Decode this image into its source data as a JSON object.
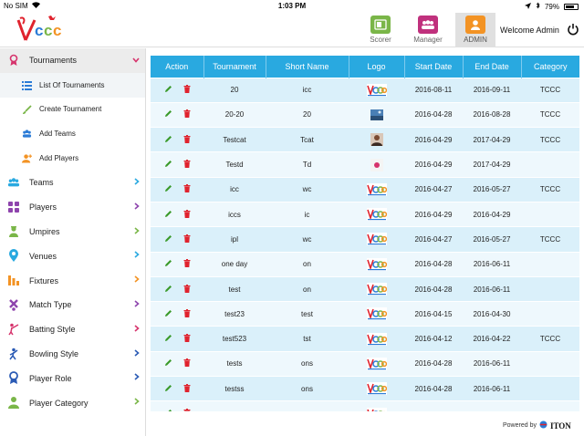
{
  "status": {
    "carrier": "No SIM",
    "time": "1:03 PM",
    "battery": "79%",
    "battery_level": 0.79
  },
  "header": {
    "tabs": [
      {
        "label": "Scorer",
        "color": "#7ab648",
        "active": false
      },
      {
        "label": "Manager",
        "color": "#c0317d",
        "active": false
      },
      {
        "label": "ADMIN",
        "color": "#f39324",
        "active": true
      }
    ],
    "welcome": "Welcome Admin"
  },
  "sidebar": {
    "items": [
      {
        "label": "Tournaments",
        "icon": "award-icon",
        "color": "#d6336c",
        "open": true
      },
      {
        "label": "List Of Tournaments",
        "icon": "list-icon",
        "color": "#2b7bd6",
        "sub": true,
        "selected": true
      },
      {
        "label": "Create Tournament",
        "icon": "brush-icon",
        "color": "#7ab648",
        "sub": true
      },
      {
        "label": "Add Teams",
        "icon": "group-icon",
        "color": "#2b7bd6",
        "sub": true
      },
      {
        "label": "Add Players",
        "icon": "add-player-icon",
        "color": "#f39324",
        "sub": true
      },
      {
        "label": "Teams",
        "icon": "teams-icon",
        "color": "#29a9e0",
        "chev_color": "#29a9e0"
      },
      {
        "label": "Players",
        "icon": "players-icon",
        "color": "#8e44ad",
        "chev_color": "#8e44ad"
      },
      {
        "label": "Umpires",
        "icon": "umpire-icon",
        "color": "#7ab648",
        "chev_color": "#7ab648"
      },
      {
        "label": "Venues",
        "icon": "location-icon",
        "color": "#29a9e0",
        "chev_color": "#29a9e0"
      },
      {
        "label": "Fixtures",
        "icon": "fixtures-icon",
        "color": "#f39324",
        "chev_color": "#f39324"
      },
      {
        "label": "Match Type",
        "icon": "match-type-icon",
        "color": "#8e44ad",
        "chev_color": "#8e44ad"
      },
      {
        "label": "Batting Style",
        "icon": "batting-icon",
        "color": "#d6336c",
        "chev_color": "#d6336c"
      },
      {
        "label": "Bowling Style",
        "icon": "bowling-icon",
        "color": "#2b5bb5",
        "chev_color": "#2b5bb5"
      },
      {
        "label": "Player Role",
        "icon": "role-icon",
        "color": "#2b5bb5",
        "chev_color": "#2b5bb5"
      },
      {
        "label": "Player Category",
        "icon": "category-icon",
        "color": "#7ab648",
        "chev_color": "#7ab648"
      }
    ]
  },
  "table": {
    "headers": [
      "Action",
      "Tournament",
      "Short Name",
      "Logo",
      "Start Date",
      "End Date",
      "Category"
    ],
    "rows": [
      {
        "tournament": "20",
        "short": "icc",
        "logo": "tccc",
        "start": "2016-08-11",
        "end": "2016-09-11",
        "category": "TCCC"
      },
      {
        "tournament": "20-20",
        "short": "20",
        "logo": "photo",
        "start": "2016-04-28",
        "end": "2016-08-28",
        "category": "TCCC"
      },
      {
        "tournament": "Testcat",
        "short": "Tcat",
        "logo": "person",
        "start": "2016-04-29",
        "end": "2017-04-29",
        "category": "TCCC"
      },
      {
        "tournament": "Testd",
        "short": "Td",
        "logo": "badge",
        "start": "2016-04-29",
        "end": "2017-04-29",
        "category": ""
      },
      {
        "tournament": "icc",
        "short": "wc",
        "logo": "tccc",
        "start": "2016-04-27",
        "end": "2016-05-27",
        "category": "TCCC"
      },
      {
        "tournament": "iccs",
        "short": "ic",
        "logo": "tccc",
        "start": "2016-04-29",
        "end": "2016-04-29",
        "category": ""
      },
      {
        "tournament": "ipl",
        "short": "wc",
        "logo": "tccc",
        "start": "2016-04-27",
        "end": "2016-05-27",
        "category": "TCCC"
      },
      {
        "tournament": "one day",
        "short": "on",
        "logo": "tccc",
        "start": "2016-04-28",
        "end": "2016-06-11",
        "category": ""
      },
      {
        "tournament": "test",
        "short": "on",
        "logo": "tccc",
        "start": "2016-04-28",
        "end": "2016-06-11",
        "category": ""
      },
      {
        "tournament": "test23",
        "short": "test",
        "logo": "tccc",
        "start": "2016-04-15",
        "end": "2016-04-30",
        "category": ""
      },
      {
        "tournament": "test523",
        "short": "tst",
        "logo": "tccc",
        "start": "2016-04-12",
        "end": "2016-04-22",
        "category": "TCCC"
      },
      {
        "tournament": "tests",
        "short": "ons",
        "logo": "tccc",
        "start": "2016-04-28",
        "end": "2016-06-11",
        "category": ""
      },
      {
        "tournament": "testss",
        "short": "ons",
        "logo": "tccc",
        "start": "2016-04-28",
        "end": "2016-06-11",
        "category": ""
      },
      {
        "tournament": "",
        "short": "",
        "logo": "tccc",
        "start": "",
        "end": "",
        "category": ""
      }
    ]
  },
  "footer": {
    "powered_by": "Powered by",
    "brand": "ITON"
  },
  "colors": {
    "accent": "#29a9e0",
    "edit": "#3a9a2a",
    "delete": "#e0232e"
  }
}
